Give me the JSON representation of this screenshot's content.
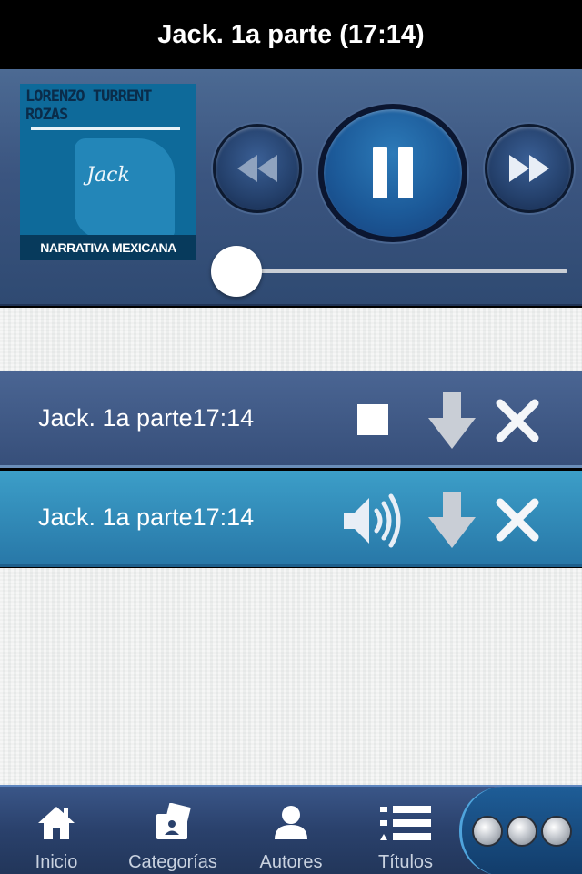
{
  "header": {
    "title": "Jack. 1a parte (17:14)"
  },
  "player": {
    "cover": {
      "author_line1": "LORENZO TURRENT",
      "author_line2": "ROZAS",
      "book_title": "Jack",
      "series": "NARRATIVA MEXICANA"
    },
    "controls": {
      "rewind_icon": "rewind-icon",
      "play_state_icon": "pause-icon",
      "forward_icon": "fast-forward-icon"
    },
    "progress_fraction": 0.0
  },
  "tracks": [
    {
      "label": "Jack. 1a parte17:14",
      "state_icon": "stop-icon",
      "download_icon": "download-arrow-icon",
      "delete_icon": "close-icon"
    },
    {
      "label": "Jack. 1a parte17:14",
      "state_icon": "speaker-icon",
      "download_icon": "download-arrow-icon",
      "delete_icon": "close-icon"
    }
  ],
  "tabbar": {
    "items": [
      {
        "label": "Inicio",
        "icon": "home-icon"
      },
      {
        "label": "Categorías",
        "icon": "categories-icon"
      },
      {
        "label": "Autores",
        "icon": "person-icon"
      },
      {
        "label": "Títulos",
        "icon": "list-icon"
      }
    ],
    "more_icon": "more-orbs-icon"
  },
  "colors": {
    "player_bg": "#3b5580",
    "active_row": "#2f8bbb",
    "inactive_row": "#3f5885",
    "tabbar_bg": "#2a416c"
  }
}
